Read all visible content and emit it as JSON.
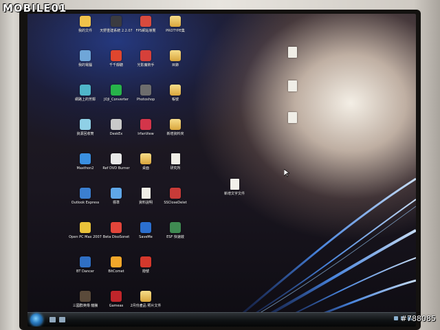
{
  "watermarks": {
    "logo": "MOBILE01",
    "photo_id": "#788085"
  },
  "desktop": {
    "icons": [
      {
        "id": "c0r0",
        "label": "我的文件",
        "icon": "documents-icon",
        "color": "#f0c24b"
      },
      {
        "id": "c0r1",
        "label": "我的電腦",
        "icon": "computer-icon",
        "color": "#6fa6d8"
      },
      {
        "id": "c0r2",
        "label": "網路上的芳鄰",
        "icon": "network-icon",
        "color": "#4fb6c9"
      },
      {
        "id": "c0r3",
        "label": "資源回收筒",
        "icon": "recycle-bin-icon",
        "color": "#8fd0e6"
      },
      {
        "id": "c0r4",
        "label": "Maxthon2",
        "icon": "browser-icon",
        "color": "#3a8fe0"
      },
      {
        "id": "c0r5",
        "label": "Outlook Express",
        "icon": "mail-icon",
        "color": "#3b7fd0"
      },
      {
        "id": "c0r6",
        "label": "Open PC Max 2007",
        "icon": "app-icon",
        "color": "#e9c23a"
      },
      {
        "id": "c0r7",
        "label": "BT Dancer",
        "icon": "app-icon",
        "color": "#2f6fc4"
      },
      {
        "id": "c0r8",
        "label": "三國群英傳 龍騰",
        "icon": "game-icon",
        "color": "#5a4a3a"
      },
      {
        "id": "c1r0",
        "label": "天野重建系統 2.2.07",
        "icon": "app-icon",
        "color": "#3b3b40"
      },
      {
        "id": "c1r1",
        "label": "千千靜聽",
        "icon": "music-player-icon",
        "color": "#e0462e"
      },
      {
        "id": "c1r2",
        "label": "JOJI_Converter",
        "icon": "app-icon",
        "color": "#27b34a"
      },
      {
        "id": "c1r3",
        "label": "DeskEx",
        "icon": "app-icon",
        "color": "#c9c9c9"
      },
      {
        "id": "c1r4",
        "label": "Ref DVD Burner",
        "icon": "app-icon",
        "color": "#e8e8e8"
      },
      {
        "id": "c1r5",
        "label": "標準",
        "icon": "app-icon",
        "color": "#5fa7e8"
      },
      {
        "id": "c1r6",
        "label": "Beta DisoSonet",
        "icon": "app-icon",
        "color": "#e2453a"
      },
      {
        "id": "c1r7",
        "label": "BitComet",
        "icon": "download-icon",
        "color": "#f2a72a"
      },
      {
        "id": "c1r8",
        "label": "Gameas",
        "icon": "game-icon",
        "color": "#c0252a"
      },
      {
        "id": "c2r0",
        "label": "FPS網站導覽",
        "icon": "app-icon",
        "color": "#d84a3e"
      },
      {
        "id": "c2r1",
        "label": "光影魔術手",
        "icon": "app-icon",
        "color": "#d6403a"
      },
      {
        "id": "c2r2",
        "label": "Photoshop",
        "icon": "app-icon",
        "color": "#6d6d6d"
      },
      {
        "id": "c2r3",
        "label": "IrfanView",
        "icon": "app-icon",
        "color": "#d3354a"
      },
      {
        "id": "c2r4",
        "label": "桌面",
        "icon": "folder-icon",
        "color": "#e8b54a"
      },
      {
        "id": "c2r5",
        "label": "資料說明",
        "icon": "document-icon",
        "color": "#efede6"
      },
      {
        "id": "c2r6",
        "label": "SaveMe",
        "icon": "app-icon",
        "color": "#2b6fcf"
      },
      {
        "id": "c2r7",
        "label": "撥號",
        "icon": "app-icon",
        "color": "#d4382c"
      },
      {
        "id": "c2r8",
        "label": "2月份產品 照片文件",
        "icon": "folder-icon",
        "color": "#e8b54a"
      },
      {
        "id": "c3r0",
        "label": "PROTYPE集",
        "icon": "folder-icon",
        "color": "#e8b54a"
      },
      {
        "id": "c3r1",
        "label": "目錄",
        "icon": "folder-icon",
        "color": "#e8b54a"
      },
      {
        "id": "c3r2",
        "label": "帳號",
        "icon": "folder-icon",
        "color": "#e8b54a"
      },
      {
        "id": "c3r3",
        "label": "新增資料夾",
        "icon": "folder-icon",
        "color": "#e8b54a"
      },
      {
        "id": "c3r4",
        "label": "研究所",
        "icon": "document-icon",
        "color": "#efede6"
      },
      {
        "id": "c3r5",
        "label": "SSCloseDelet",
        "icon": "app-icon",
        "color": "#c83b38"
      },
      {
        "id": "c3r6",
        "label": "ESF 快速啟",
        "icon": "app-icon",
        "color": "#3f8a52"
      },
      {
        "id": "c5r5",
        "label": "新增文字文件",
        "icon": "text-document-icon",
        "color": "#f2f0ea"
      },
      {
        "id": "c7r1",
        "label": "",
        "icon": "document-icon",
        "color": "#efede6"
      },
      {
        "id": "c7r2",
        "label": "",
        "icon": "document-icon",
        "color": "#efede6"
      },
      {
        "id": "c7r3",
        "label": "",
        "icon": "document-icon",
        "color": "#efede6"
      }
    ]
  },
  "taskbar": {
    "start_icon": "windows-orb-icon",
    "clock": "",
    "tray_icons": [
      "network-icon",
      "volume-icon",
      "speaker-icon"
    ]
  }
}
